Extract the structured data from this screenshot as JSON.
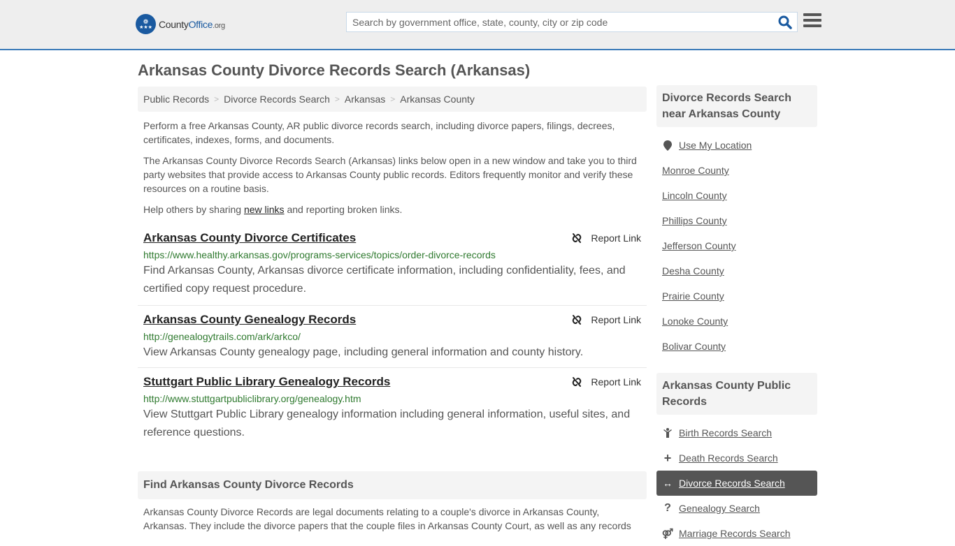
{
  "header": {
    "logo": {
      "word1": "County",
      "word2": "Office",
      "tld": ".org"
    },
    "search": {
      "placeholder": "Search by government office, state, county, city or zip code",
      "value": ""
    },
    "accent_color": "#3a7ab8",
    "brand_color": "#1a5aa0"
  },
  "page": {
    "title": "Arkansas County Divorce Records Search (Arkansas)",
    "breadcrumb": [
      "Public Records",
      "Divorce Records Search",
      "Arkansas",
      "Arkansas County"
    ],
    "intro": {
      "p1": "Perform a free Arkansas County, AR public divorce records search, including divorce papers, filings, decrees, certificates, indexes, forms, and documents.",
      "p2": "The Arkansas County Divorce Records Search (Arkansas) links below open in a new window and take you to third party websites that provide access to Arkansas County public records. Editors frequently monitor and verify these resources on a routine basis.",
      "p3_before": "Help others by sharing ",
      "p3_link": "new links",
      "p3_after": " and reporting broken links."
    },
    "results": [
      {
        "title": "Arkansas County Divorce Certificates",
        "url": "https://www.healthy.arkansas.gov/programs-services/topics/order-divorce-records",
        "description": "Find Arkansas County, Arkansas divorce certificate information, including confidentiality, fees, and certified copy request procedure.",
        "report_label": "Report Link"
      },
      {
        "title": "Arkansas County Genealogy Records",
        "url": "http://genealogytrails.com/ark/arkco/",
        "description": "View Arkansas County genealogy page, including general information and county history.",
        "report_label": "Report Link"
      },
      {
        "title": "Stuttgart Public Library Genealogy Records",
        "url": "http://www.stuttgartpubliclibrary.org/genealogy.htm",
        "description": "View Stuttgart Public Library genealogy information including general information, useful sites, and reference questions.",
        "report_label": "Report Link"
      }
    ],
    "find_section": {
      "heading": "Find Arkansas County Divorce Records",
      "body": "Arkansas County Divorce Records are legal documents relating to a couple's divorce in Arkansas County, Arkansas. They include the divorce papers that the couple files in Arkansas County Court, as well as any records"
    }
  },
  "sidebar": {
    "nearby": {
      "heading": "Divorce Records Search near Arkansas County",
      "use_location": "Use My Location",
      "counties": [
        "Monroe County",
        "Lincoln County",
        "Phillips County",
        "Jefferson County",
        "Desha County",
        "Prairie County",
        "Lonoke County",
        "Bolivar County"
      ]
    },
    "public_records": {
      "heading": "Arkansas County Public Records",
      "items": [
        {
          "label": "Birth Records Search",
          "icon": "child-icon",
          "glyph": "Ὣ8",
          "active": false
        },
        {
          "label": "Death Records Search",
          "icon": "plus-icon",
          "glyph": "+",
          "active": false
        },
        {
          "label": "Divorce Records Search",
          "icon": "arrows-horizontal-icon",
          "glyph": "↔",
          "active": true
        },
        {
          "label": "Genealogy Search",
          "icon": "question-icon",
          "glyph": "?",
          "active": false
        },
        {
          "label": "Marriage Records Search",
          "icon": "marriage-icon",
          "glyph": "⚤",
          "active": false
        }
      ]
    }
  }
}
